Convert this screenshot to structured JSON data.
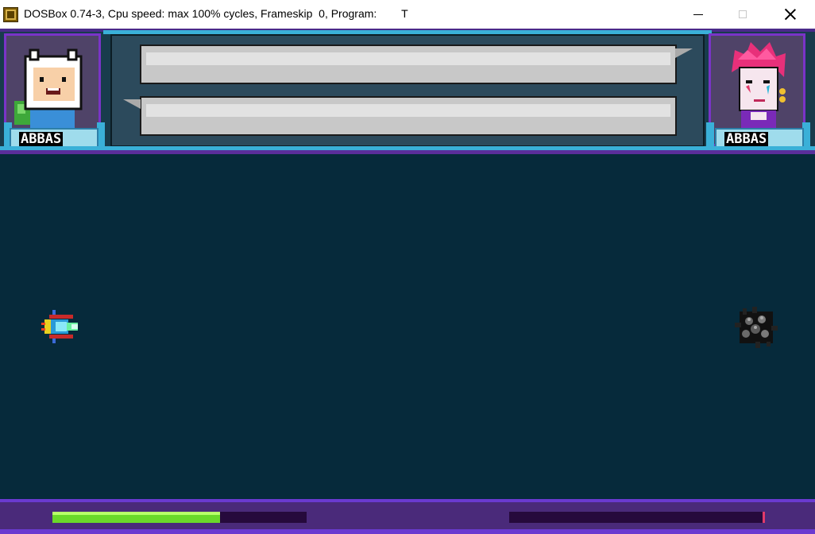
{
  "window": {
    "title": "DOSBox 0.74-3, Cpu speed: max 100% cycles, Frameskip  0, Program:        T",
    "app_icon": "dosbox-icon",
    "controls": {
      "minimize": "minimize-icon",
      "maximize": "maximize-icon",
      "close": "close-icon"
    }
  },
  "hud": {
    "player_left": {
      "name": "ABBAS",
      "portrait": "hooded-boy-portrait"
    },
    "player_right": {
      "name": "ABBAS",
      "portrait": "pink-hair-jester-portrait"
    },
    "dialogue": {
      "line1": "",
      "line2": ""
    }
  },
  "health": {
    "left_fraction": 0.66,
    "right_fraction": 0.0,
    "left_color": "#6ad82a",
    "right_color": "#e23a6a"
  },
  "colors": {
    "arena_bg": "#062a3b",
    "frame_purple": "#7a34c8",
    "frame_cyan": "#3ab0d8"
  }
}
